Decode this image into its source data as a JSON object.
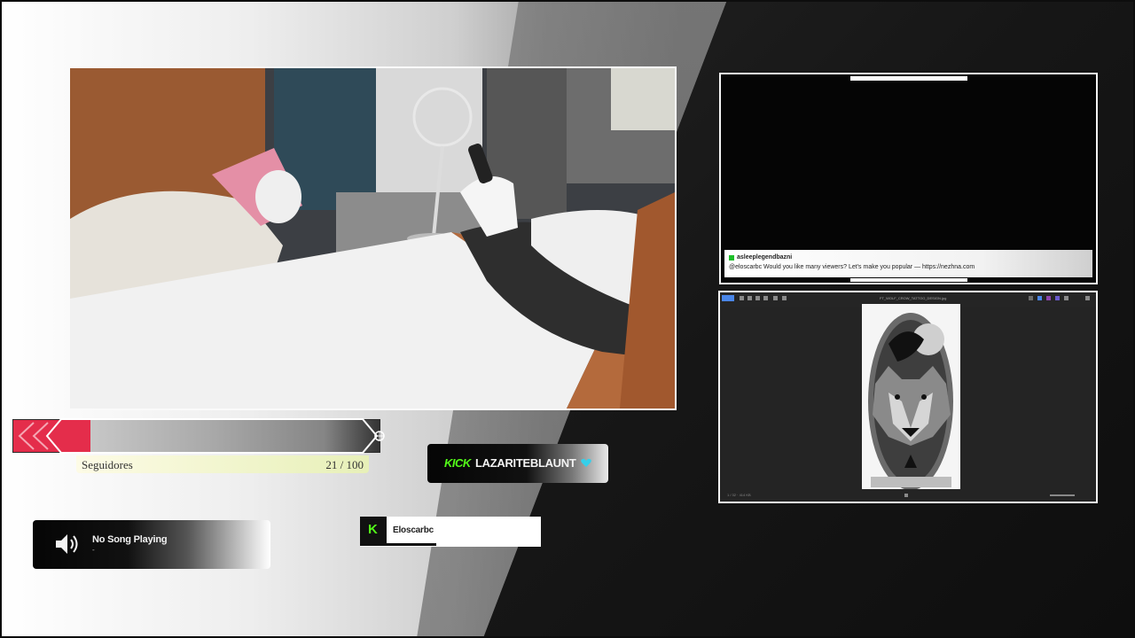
{
  "chat": {
    "username": "asleeplegendbazni",
    "message": "@eloscarbc Would you like many viewers? Let's make you popular — https://nezhna.com"
  },
  "follower_goal": {
    "label": "Seguidores",
    "count_text": "21 / 100",
    "current": 21,
    "target": 100,
    "progress_fraction": 0.21,
    "fill_color": "#e42d4b"
  },
  "kick_tag": {
    "brand": "KICK",
    "channel": "LAZARITEBLAUNT",
    "brand_color": "#53fc18",
    "heart_color": "#35d0ea"
  },
  "now_playing": {
    "title": "No Song Playing",
    "artist": "-",
    "icon": "speaker-icon"
  },
  "latest_follower": {
    "badge": "K",
    "name": "Eloscarbc"
  },
  "viewer": {
    "filename": "FT_WOLF_CROW_TATTOO_DESIGN.jpg",
    "status": "1 / 32 · 414 KB"
  }
}
